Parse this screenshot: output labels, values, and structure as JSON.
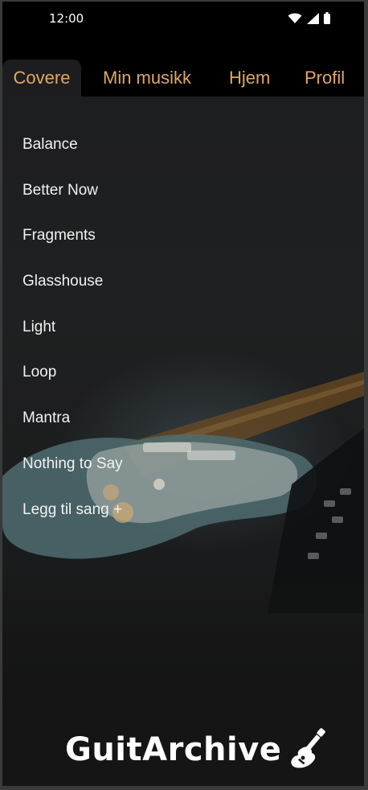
{
  "status_bar": {
    "time": "12:00",
    "icons": [
      "wifi-icon",
      "signal-icon",
      "battery-icon"
    ]
  },
  "tabs": [
    {
      "label": "Covere",
      "active": true
    },
    {
      "label": "Min musikk",
      "active": false
    },
    {
      "label": "Hjem",
      "active": false
    },
    {
      "label": "Profil",
      "active": false
    }
  ],
  "songs": [
    {
      "title": "Balance"
    },
    {
      "title": "Better Now"
    },
    {
      "title": "Fragments"
    },
    {
      "title": "Glasshouse"
    },
    {
      "title": "Light"
    },
    {
      "title": "Loop"
    },
    {
      "title": "Mantra"
    },
    {
      "title": "Nothing to Say"
    }
  ],
  "add_song_label": "Legg til sang +",
  "brand": {
    "name": "GuitArchive",
    "icon": "guitar-icon"
  },
  "colors": {
    "tab_text": "#e0a763",
    "tab_bar_bg": "#000000",
    "screen_bg": "#1b1c1e",
    "list_text": "#f2f2f2"
  }
}
